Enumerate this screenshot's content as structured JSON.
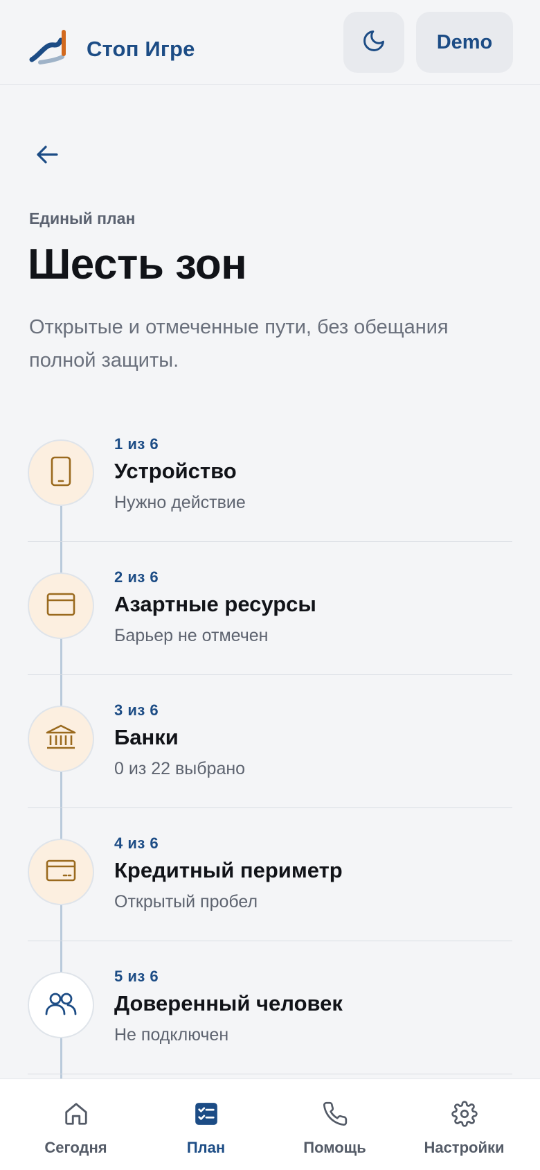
{
  "app": {
    "name": "Стоп Игре"
  },
  "header": {
    "demo_label": "Demo"
  },
  "intro": {
    "eyebrow": "Единый план",
    "title": "Шесть зон",
    "subtitle": "Открытые и отмеченные пути, без обещания полной защиты."
  },
  "zones": [
    {
      "step": "1 из 6",
      "name": "Устройство",
      "status": "Нужно действие",
      "icon": "phone-icon"
    },
    {
      "step": "2 из 6",
      "name": "Азартные ресурсы",
      "status": "Барьер не отмечен",
      "icon": "browser-window-icon"
    },
    {
      "step": "3 из 6",
      "name": "Банки",
      "status": "0 из 22 выбрано",
      "icon": "bank-icon"
    },
    {
      "step": "4 из 6",
      "name": "Кредитный периметр",
      "status": "Открытый пробел",
      "icon": "credit-card-icon"
    },
    {
      "step": "5 из 6",
      "name": "Доверенный человек",
      "status": "Не подключен",
      "icon": "users-icon"
    }
  ],
  "nav": {
    "items": [
      {
        "label": "Сегодня",
        "icon": "home-icon",
        "active": false
      },
      {
        "label": "План",
        "icon": "checklist-icon",
        "active": true
      },
      {
        "label": "Помощь",
        "icon": "phone-call-icon",
        "active": false
      },
      {
        "label": "Настройки",
        "icon": "gear-icon",
        "active": false
      }
    ]
  },
  "colors": {
    "accent": "#1c4c85",
    "icon_brown": "#9a6a1e",
    "icon_bg": "#fcefe0",
    "background": "#f4f5f7"
  }
}
